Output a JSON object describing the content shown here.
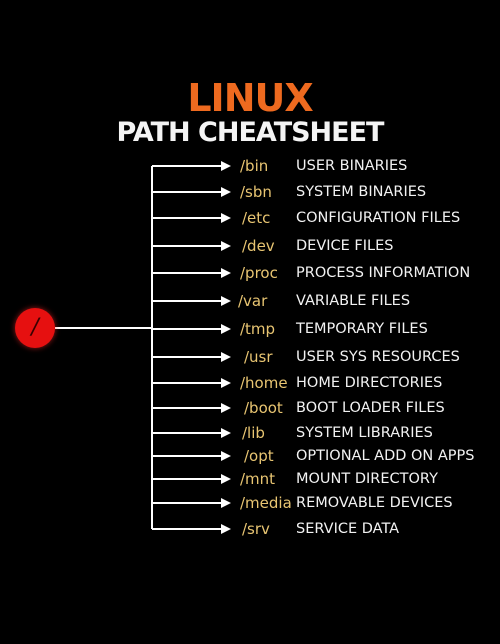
{
  "title": {
    "line1": "LINUX",
    "line2": "PATH CHEATSHEET"
  },
  "root": {
    "label": "/",
    "icon": "root-circle"
  },
  "colors": {
    "title_accent": "#ee6a1f",
    "path": "#e8c572",
    "root": "#e61010",
    "line": "#ffffff",
    "background": "#000000"
  },
  "entries": [
    {
      "path": "/bin",
      "desc": "USER BINARIES"
    },
    {
      "path": "/sbn",
      "desc": "SYSTEM BINARIES"
    },
    {
      "path": "/etc",
      "desc": "CONFIGURATION FILES"
    },
    {
      "path": "/dev",
      "desc": "DEVICE FILES"
    },
    {
      "path": "/proc",
      "desc": "PROCESS INFORMATION"
    },
    {
      "path": "/var",
      "desc": "VARIABLE FILES"
    },
    {
      "path": "/tmp",
      "desc": "TEMPORARY FILES"
    },
    {
      "path": "/usr",
      "desc": "USER SYS RESOURCES"
    },
    {
      "path": "/home",
      "desc": "HOME DIRECTORIES"
    },
    {
      "path": "/boot",
      "desc": "BOOT LOADER FILES"
    },
    {
      "path": "/lib",
      "desc": "SYSTEM LIBRARIES"
    },
    {
      "path": "/opt",
      "desc": "OPTIONAL ADD ON APPS"
    },
    {
      "path": "/mnt",
      "desc": "MOUNT DIRECTORY"
    },
    {
      "path": "/media",
      "desc": "REMOVABLE DEVICES"
    },
    {
      "path": "/srv",
      "desc": "SERVICE DATA"
    }
  ]
}
